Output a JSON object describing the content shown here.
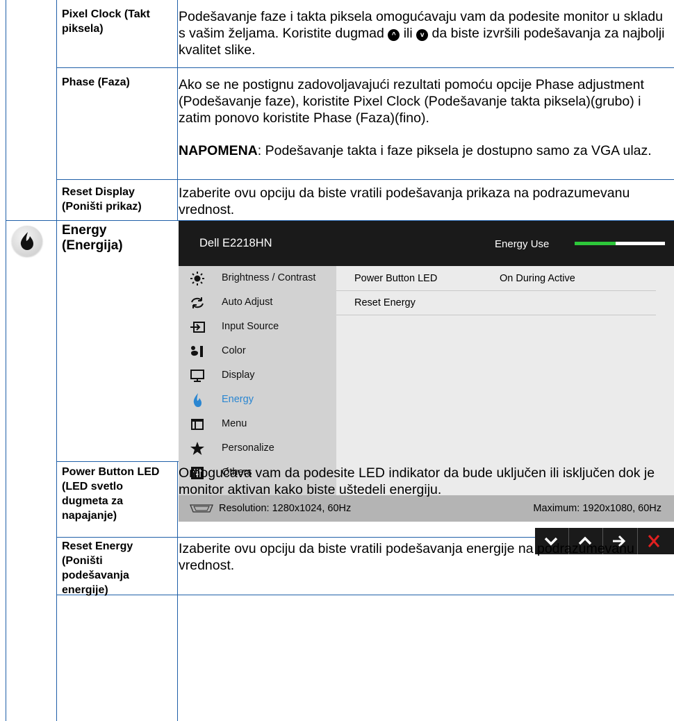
{
  "rows": [
    {
      "label": "Pixel Clock (Takt piksela)",
      "desc_parts": [
        "Podešavanje faze i takta piksela omogućavaju vam da podesite monitor u skladu s vašim željama. Koristite dugmad ",
        " ili ",
        " da biste izvršili podešavanja za najbolji kvalitet slike."
      ]
    },
    {
      "label": "Phase (Faza)",
      "desc": "Ako se ne postignu zadovoljavajući rezultati pomoću opcije Phase adjustment (Podešavanje faze), koristite Pixel Clock (Podešavanje takta piksela)(grubo) i zatim ponovo koristite Phase (Faza)(fino).",
      "note_bold": "NAPOMENA",
      "note_text": ": Podešavanje takta i faze piksela je dostupno samo za VGA ulaz."
    },
    {
      "label": "Reset Display (Poništi prikaz)",
      "desc": "Izaberite ovu opciju da biste vratili podešavanja prikaza na podrazumevanu vrednost."
    },
    {
      "label": "Energy (Energija)",
      "icon": "energy-icon"
    },
    {
      "label": "Power Button LED (LED svetlo dugmeta za napajanje)",
      "desc": "Omogućava vam da podesite LED indikator da bude uključen ili isključen dok je monitor aktivan kako biste uštedeli energiju."
    },
    {
      "label": "Reset Energy (Poništi podešavanja energije)",
      "desc": "Izaberite ovu opciju da biste vratili podešavanja energije na podrazumevanu vrednost."
    }
  ],
  "osd": {
    "title": "Dell E2218HN",
    "energy_use_label": "Energy Use",
    "energy_use_level": 0.45,
    "menu": [
      {
        "label": "Brightness / Contrast",
        "icon": "sun-icon"
      },
      {
        "label": "Auto Adjust",
        "icon": "auto-adjust-icon"
      },
      {
        "label": "Input Source",
        "icon": "input-source-icon"
      },
      {
        "label": "Color",
        "icon": "color-icon"
      },
      {
        "label": "Display",
        "icon": "display-icon"
      },
      {
        "label": "Energy",
        "icon": "energy-icon",
        "active": true
      },
      {
        "label": "Menu",
        "icon": "menu-icon"
      },
      {
        "label": "Personalize",
        "icon": "star-icon"
      },
      {
        "label": "Others",
        "icon": "others-icon"
      }
    ],
    "settings": [
      {
        "name": "Power Button LED",
        "value": "On During Active"
      },
      {
        "name": "Reset Energy",
        "value": ""
      }
    ],
    "resolution": "Resolution: 1280x1024, 60Hz",
    "maximum": "Maximum: 1920x1080, 60Hz"
  },
  "nav_buttons": [
    {
      "name": "down",
      "icon": "chevron-down-icon"
    },
    {
      "name": "up",
      "icon": "chevron-up-icon"
    },
    {
      "name": "enter",
      "icon": "arrow-right-icon"
    },
    {
      "name": "exit",
      "icon": "close-icon"
    }
  ],
  "colors": {
    "border": "#1f5fa8",
    "osd_header": "#1a1a1a",
    "energy_green": "#2dc83a",
    "active_blue": "#2a86d1",
    "exit_red": "#e02020"
  }
}
